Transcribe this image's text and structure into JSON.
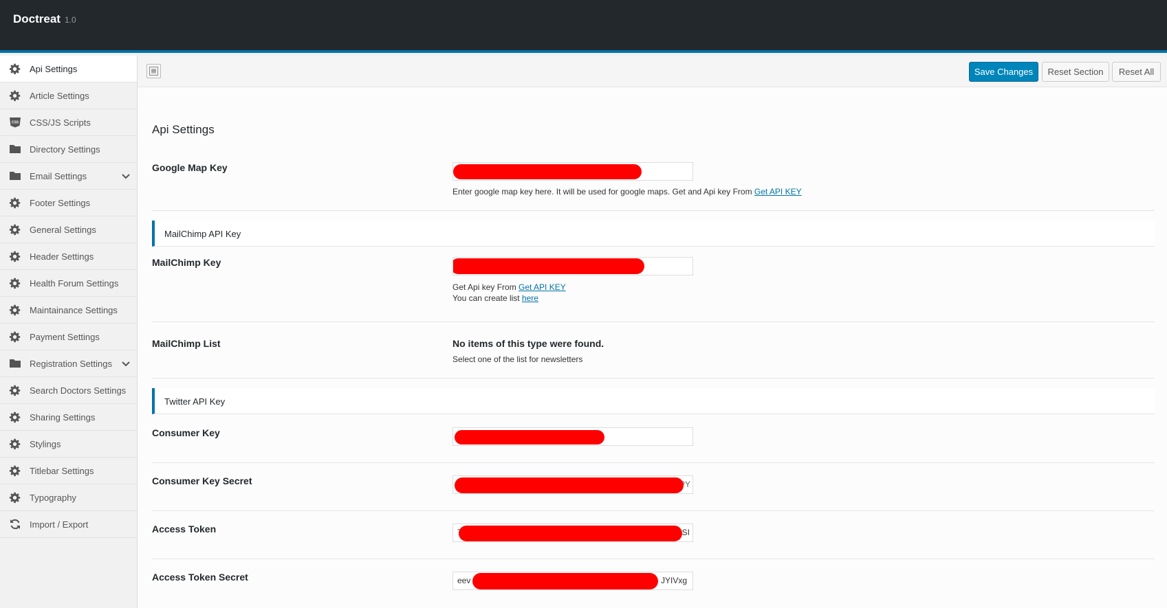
{
  "header": {
    "brand": "Doctreat",
    "version": "1.0"
  },
  "sidebar": {
    "items": [
      {
        "label": "Api Settings",
        "icon": "gear-icon"
      },
      {
        "label": "Article Settings",
        "icon": "gear-icon"
      },
      {
        "label": "CSS/JS Scripts",
        "icon": "css-icon"
      },
      {
        "label": "Directory Settings",
        "icon": "folder-icon"
      },
      {
        "label": "Email Settings",
        "icon": "folder-icon"
      },
      {
        "label": "Footer Settings",
        "icon": "gear-icon"
      },
      {
        "label": "General Settings",
        "icon": "gear-icon"
      },
      {
        "label": "Header Settings",
        "icon": "gear-icon"
      },
      {
        "label": "Health Forum Settings",
        "icon": "gear-icon"
      },
      {
        "label": "Maintainance Settings",
        "icon": "gear-icon"
      },
      {
        "label": "Payment Settings",
        "icon": "gear-icon"
      },
      {
        "label": "Registration Settings",
        "icon": "folder-icon"
      },
      {
        "label": "Search Doctors Settings",
        "icon": "gear-icon"
      },
      {
        "label": "Sharing Settings",
        "icon": "gear-icon"
      },
      {
        "label": "Stylings",
        "icon": "gear-icon"
      },
      {
        "label": "Titlebar Settings",
        "icon": "gear-icon"
      },
      {
        "label": "Typography",
        "icon": "gear-icon"
      },
      {
        "label": "Import / Export",
        "icon": "refresh-icon"
      }
    ]
  },
  "toolbar": {
    "save_label": "Save Changes",
    "reset_section_label": "Reset Section",
    "reset_all_label": "Reset All"
  },
  "main": {
    "title": "Api Settings",
    "google_map": {
      "label": "Google Map Key",
      "desc_text": "Enter google map key here. It will be used for google maps. Get and Api key From ",
      "desc_link": "Get API KEY"
    },
    "mailchimp_section": "MailChimp API Key",
    "mailchimp_key": {
      "label": "MailChimp Key",
      "desc1_text": "Get Api key From ",
      "desc1_link": "Get API KEY ",
      "desc2_text": "You can create list ",
      "desc2_link": "here"
    },
    "mailchimp_list": {
      "label": "MailChimp List",
      "empty_text": "No items of this type were found.",
      "desc": "Select one of the list for newsletters"
    },
    "twitter_section": "Twitter API Key",
    "consumer_key": {
      "label": "Consumer Key",
      "value": ""
    },
    "consumer_key_secret": {
      "label": "Consumer Key Secret",
      "value_tail": "PY"
    },
    "access_token": {
      "label": "Access Token",
      "value_head": "T",
      "value_tail": "SI"
    },
    "access_token_secret": {
      "label": "Access Token Secret",
      "value_head": "eev",
      "value_tail": "JYIVxg"
    }
  }
}
